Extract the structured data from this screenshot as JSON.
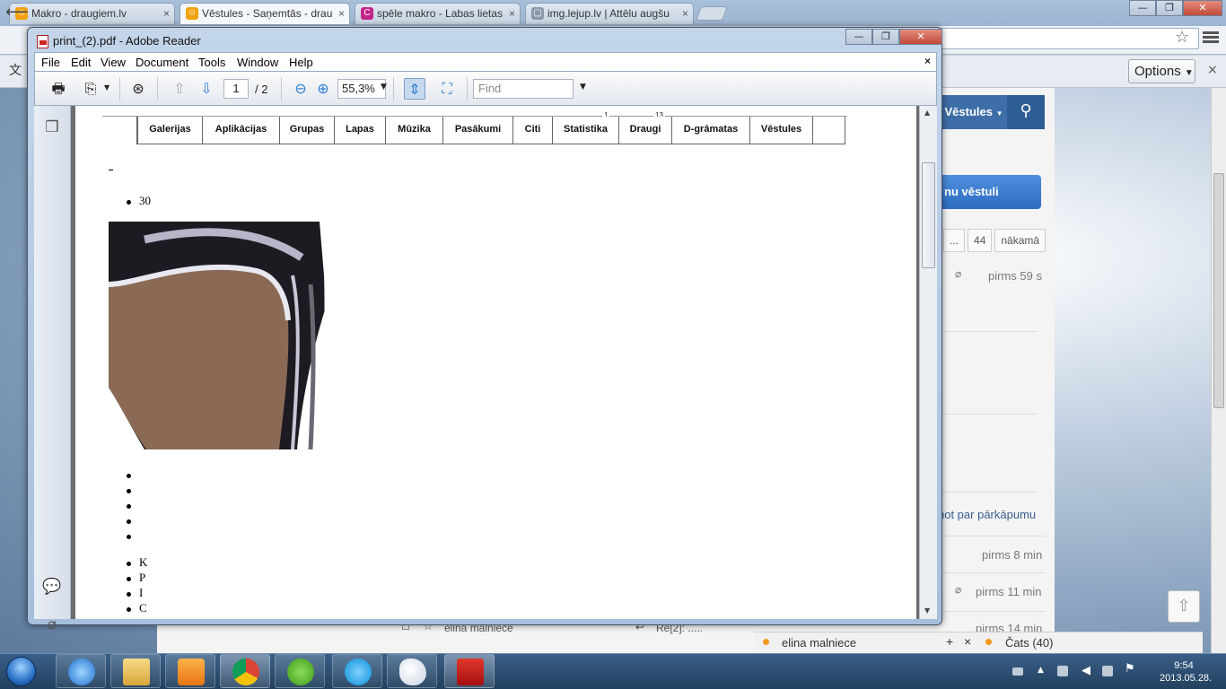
{
  "chrome": {
    "tabs": [
      {
        "title": "Makro - draugiem.lv"
      },
      {
        "title": "Vēstules - Saņemtās - drau"
      },
      {
        "title": "spēle makro - Labas lietas"
      },
      {
        "title": "img.lejup.lv | Attēlu augšu"
      }
    ],
    "options_label": "Options",
    "win_min": "—",
    "win_max": "❐",
    "win_close": "✕"
  },
  "site": {
    "nav_label": "Vēstules",
    "new_message_label": "nu vēstuli",
    "pager": [
      "...",
      "44",
      "nākamā"
    ],
    "times": [
      "pirms 59 s",
      "pirms 8 min",
      "pirms 11 min",
      "pirms 14 min"
    ],
    "report_label": "ņot par pārkāpumu",
    "bottom_sender": "elina malniece",
    "bottom_subject": "Re[2]: .....",
    "chat_user": "elina malniece",
    "chat_label": "Čats (40)"
  },
  "reader": {
    "title": "print_(2).pdf - Adobe Reader",
    "menu": [
      "File",
      "Edit",
      "View",
      "Document",
      "Tools",
      "Window",
      "Help"
    ],
    "menu_close": "×",
    "page_current": "1",
    "page_total": "/ 2",
    "zoom": "55,3%",
    "find_placeholder": "Find"
  },
  "pdf": {
    "nav_tabs": [
      "Galerijas",
      "Aplikācijas",
      "Grupas",
      "Lapas",
      "Mūzika",
      "Pasākumi",
      "Citi",
      "Statistika",
      "Draugi",
      "D-grāmatas",
      "Vēstules"
    ],
    "badge_1": "1",
    "badge_2": "13",
    "count_item": "30",
    "letter_items": [
      "K",
      "P",
      "I",
      "C"
    ]
  },
  "taskbar": {
    "time": "9:54",
    "date": "2013.05.28."
  },
  "colors": {
    "reader_frame": "#a5bfdc",
    "site_blue": "#3e6ea8",
    "chat_orange": "#f39a1e",
    "taskbar": "#2a4a6e"
  }
}
